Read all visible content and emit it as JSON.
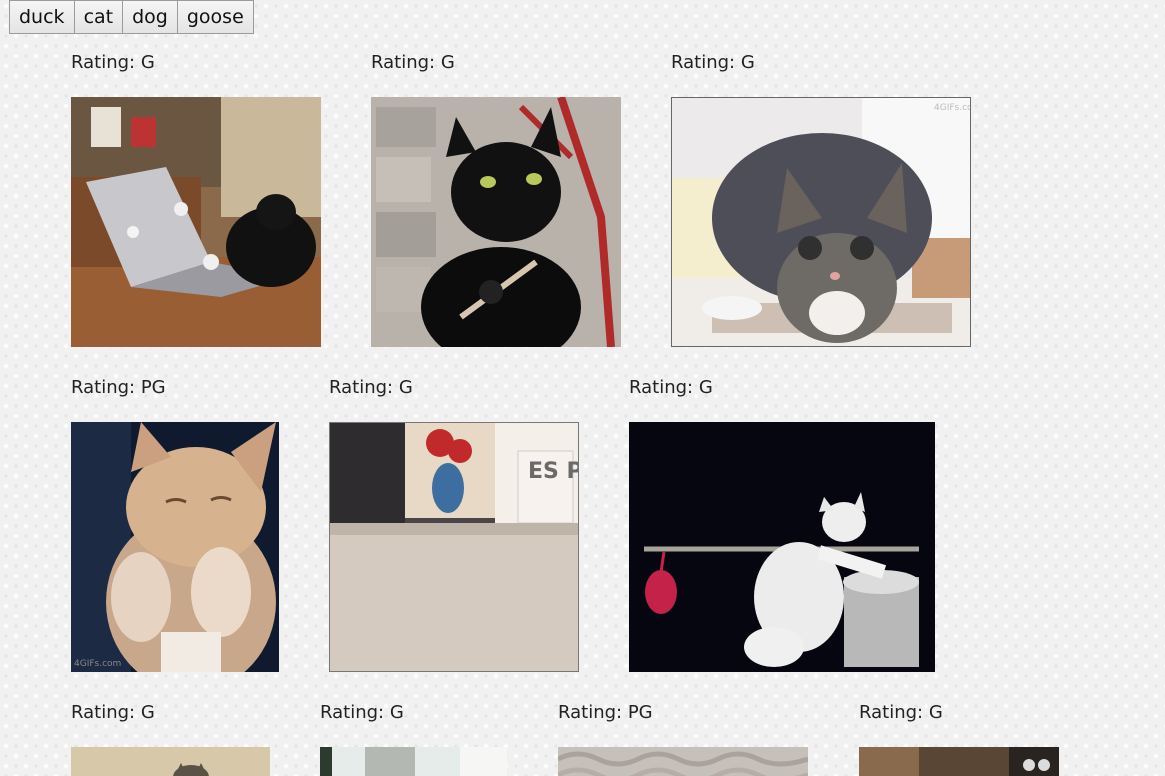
{
  "search_buttons": [
    "duck",
    "cat",
    "dog",
    "goose"
  ],
  "results": [
    {
      "rating": "Rating: G",
      "image_label": "cat typing on laptop"
    },
    {
      "rating": "Rating: G",
      "image_label": "black cat with nail file"
    },
    {
      "rating": "Rating: G",
      "image_label": "tabby cat crouching"
    },
    {
      "rating": "Rating: PG",
      "image_label": "orange kitten with raised paws"
    },
    {
      "rating": "Rating: G",
      "image_label": "cat on carpet ESPN"
    },
    {
      "rating": "Rating: G",
      "image_label": "white cat on bar"
    },
    {
      "rating": "Rating: G",
      "image_label": "cat peeking"
    },
    {
      "rating": "Rating: G",
      "image_label": "cat in doorway"
    },
    {
      "rating": "Rating: PG",
      "image_label": "cat on knit blanket"
    },
    {
      "rating": "Rating: G",
      "image_label": "cat in room"
    }
  ],
  "espn_sign": "ES PN",
  "watermarks": {
    "gif_site": "4GIFs.com"
  }
}
